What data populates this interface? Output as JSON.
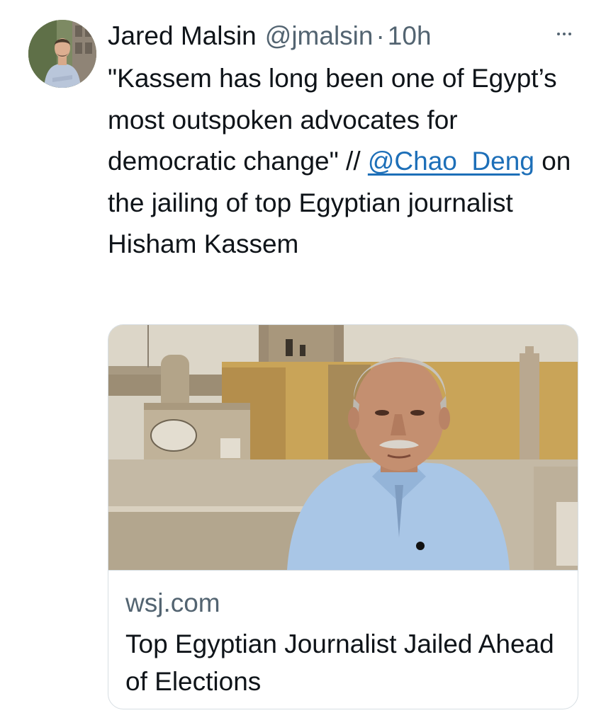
{
  "tweet": {
    "author_name": "Jared Malsin",
    "author_handle": "@jmalsin",
    "separator": "·",
    "time": "10h",
    "text_before": "\"Kassem has long been one of Egypt’s most outspoken advocates for democratic change\" // ",
    "mention": "@Chao_Deng",
    "text_after": " on the jailing of top Egyptian journalist Hisham Kassem"
  },
  "card": {
    "domain": "wsj.com",
    "title": "Top Egyptian Journalist Jailed Ahead of Elections",
    "image_subject": "portrait-photo-cemetery"
  },
  "icons": {
    "more": "more-options-icon",
    "avatar": "profile-avatar"
  },
  "colors": {
    "link": "#1d6fb8",
    "secondary_text": "#536471",
    "border": "#d7dee3"
  }
}
